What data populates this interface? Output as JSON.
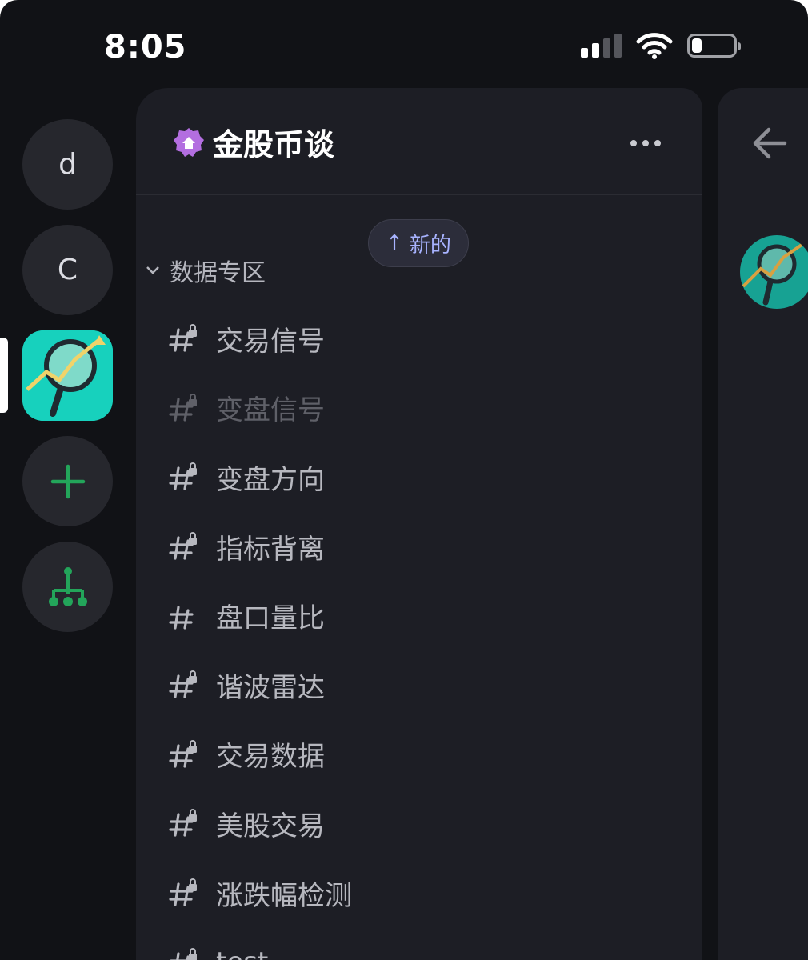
{
  "status_bar": {
    "time": "8:05"
  },
  "rail": {
    "items": [
      {
        "label": "d"
      },
      {
        "label": "C"
      }
    ]
  },
  "server": {
    "name": "金股币谈",
    "new_label": "新的",
    "category": "数据专区",
    "channels": [
      {
        "name": "交易信号",
        "muted": false,
        "locked": true
      },
      {
        "name": "变盘信号",
        "muted": true,
        "locked": true
      },
      {
        "name": "变盘方向",
        "muted": false,
        "locked": true
      },
      {
        "name": "指标背离",
        "muted": false,
        "locked": true
      },
      {
        "name": "盘口量比",
        "muted": false,
        "locked": false
      },
      {
        "name": "谐波雷达",
        "muted": false,
        "locked": true
      },
      {
        "name": "交易数据",
        "muted": false,
        "locked": true
      },
      {
        "name": "美股交易",
        "muted": false,
        "locked": true
      },
      {
        "name": "涨跌幅检测",
        "muted": false,
        "locked": true
      },
      {
        "name": "test",
        "muted": false,
        "locked": true
      }
    ]
  },
  "colors": {
    "accent_green": "#23a55a",
    "server_icon_bg": "#17d1bd",
    "new_pill_text": "#a8b3ff",
    "badge_purple": "#b36ee0"
  }
}
